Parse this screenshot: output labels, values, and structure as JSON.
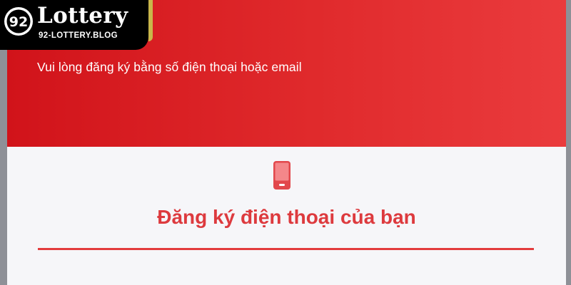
{
  "logo": {
    "mark_text": "92",
    "name": "Lottery",
    "domain": "92-LOTTERY.BLOG"
  },
  "header": {
    "subtitle": "Vui lòng đăng ký bằng số điện thoại hoặc email"
  },
  "register": {
    "icon": "phone-icon",
    "title": "Đăng ký điện thoại của bạn"
  },
  "colors": {
    "brand_red": "#dd3a3e",
    "header_red": "#d1131a",
    "logo_gold": "#c9b64a"
  }
}
